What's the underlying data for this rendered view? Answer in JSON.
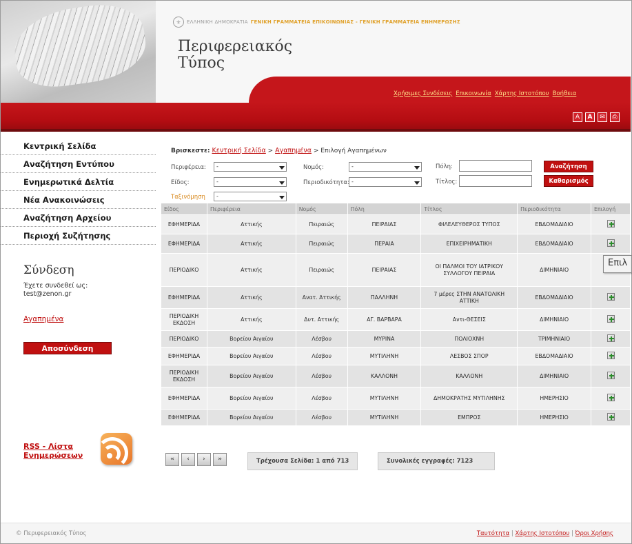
{
  "header": {
    "gov_hellenic": "ΕΛΛΗΝΙΚΗ ΔΗΜΟΚΡΑΤΙΑ",
    "gov_secretariat": "ΓΕΝΙΚΗ ΓΡΑΜΜΑΤΕΙΑ ΕΠΙΚΟΙΝΩΝΙΑΣ - ΓΕΝΙΚΗ ΓΡΑΜΜΑΤΕΙΑ ΕΝΗΜΕΡΩΣΗΣ",
    "site_title": "Περιφερειακός Τύπος",
    "top_links": [
      "Χρήσιμες Συνδέσεις",
      "Επικοινωνία",
      "Χάρτης Ιστοτόπου",
      "Βοήθεια"
    ],
    "tool_icons": [
      "font-small-icon",
      "font-large-icon",
      "email-icon",
      "print-icon"
    ]
  },
  "sidebar": {
    "nav": [
      "Κεντρική Σελίδα",
      "Αναζήτηση Εντύπου",
      "Ενημερωτικά Δελτία",
      "Νέα Ανακοινώσεις",
      "Αναζήτηση Αρχείου",
      "Περιοχή Συζήτησης"
    ],
    "login_title": "Σύνδεση",
    "login_sub": "Έχετε συνδεθεί ως:",
    "login_user": "test@zenon.gr",
    "favorites_link": "Αγαπημένα",
    "logout_button": "Αποσύνδεση",
    "rss_line1": "RSS - Λίστα",
    "rss_line2": "Ενημερώσεων"
  },
  "breadcrumb": {
    "label": "Βρισκεστε:",
    "home": "Κεντρική Σελίδα",
    "favorites": "Αγαπημένα",
    "current": "> Επιλογή Αγαπημένων"
  },
  "filters": {
    "region_label": "Περιφέρεια:",
    "region_value": "-",
    "prefecture_label": "Νομός:",
    "prefecture_value": "-",
    "city_label": "Πόλη:",
    "type_label": "Είδος:",
    "type_value": "-",
    "frequency_label": "Περιοδικότητα:",
    "frequency_value": "-",
    "title_label": "Τίτλος:",
    "sort_label": "Ταξινόμηση",
    "sort_value": "-",
    "search_button": "Αναζήτηση",
    "clear_button": "Καθαρισμός"
  },
  "table": {
    "headers": [
      "Είδος",
      "Περιφέρεια",
      "Νομός",
      "Πόλη",
      "Τίτλος",
      "Περιοδικότητα",
      "Επιλογή"
    ],
    "rows": [
      [
        "ΕΦΗΜΕΡΙΔΑ",
        "Αττικής",
        "Πειραιώς",
        "ΠΕΙΡΑΙΑΣ",
        "ΦΙΛΕΛΕΥΘΕΡΟΣ ΤΥΠΟΣ",
        "ΕΒΔΟΜΑΔΙΑΙΟ"
      ],
      [
        "ΕΦΗΜΕΡΙΔΑ",
        "Αττικής",
        "Πειραιώς",
        "ΠΕΡΑΙΑ",
        "ΕΠΙΧΕΙΡΗΜΑΤΙΚΗ",
        "ΕΒΔΟΜΑΔΙΑΙΟ"
      ],
      [
        "ΠΕΡΙΟΔΙΚΟ",
        "Αττικής",
        "Πειραιώς",
        "ΠΕΙΡΑΙΑΣ",
        "ΟΙ ΠΑΛΜΟΙ ΤΟΥ ΙΑΤΡΙΚΟΥ ΣΥΛΛΟΓΟΥ ΠΕΙΡΑΙΑ",
        "ΔΙΜΗΝΙΑΙΟ"
      ],
      [
        "ΕΦΗΜΕΡΙΔΑ",
        "Αττικής",
        "Ανατ. Αττικής",
        "ΠΑΛΛΗΝΗ",
        "7 μέρες ΣΤΗΝ ΑΝΑΤΟΛΙΚΗ ΑΤΤΙΚΗ",
        "ΕΒΔΟΜΑΔΙΑΙΟ"
      ],
      [
        "ΠΕΡΙΟΔΙΚΗ ΕΚΔΟΣΗ",
        "Αττικής",
        "Δυτ. Αττικής",
        "ΑΓ. ΒΑΡΒΑΡΑ",
        "Αντι-ΘΕΣΕΙΣ",
        "ΔΙΜΗΝΙΑΙΟ"
      ],
      [
        "ΠΕΡΙΟΔΙΚΟ",
        "Βορείου Αιγαίου",
        "Λέσβου",
        "ΜΥΡΙΝΑ",
        "ΠΟΛΙΟΧΝΗ",
        "ΤΡΙΜΗΝΙΑΙΟ"
      ],
      [
        "ΕΦΗΜΕΡΙΔΑ",
        "Βορείου Αιγαίου",
        "Λέσβου",
        "ΜΥΤΙΛΗΝΗ",
        "ΛΕΣΒΟΣ ΣΠΟΡ",
        "ΕΒΔΟΜΑΔΙΑΙΟ"
      ],
      [
        "ΠΕΡΙΟΔΙΚΗ ΕΚΔΟΣΗ",
        "Βορείου Αιγαίου",
        "Λέσβου",
        "ΚΑΛΛΟΝΗ",
        "ΚΑΛΛΟΝΗ",
        "ΔΙΜΗΝΙΑΙΟ"
      ],
      [
        "ΕΦΗΜΕΡΙΔΑ",
        "Βορείου Αιγαίου",
        "Λέσβου",
        "ΜΥΤΙΛΗΝΗ",
        "ΔΗΜΟΚΡΑΤΗΣ ΜΥΤΙΛΗΝΗΣ",
        "ΗΜΕΡΗΣΙΟ"
      ],
      [
        "ΕΦΗΜΕΡΙΔΑ",
        "Βορείου Αιγαίου",
        "Λέσβου",
        "ΜΥΤΙΛΗΝΗ",
        "ΕΜΠΡΟΣ",
        "ΗΜΕΡΗΣΙΟ"
      ]
    ],
    "tooltip": "Επιλ"
  },
  "pager": {
    "first": "«",
    "prev": "‹",
    "next": "›",
    "last": "»",
    "current_page": "Τρέχουσα Σελίδα: 1 από 713",
    "total_records": "Συνολικές εγγραφές: 7123"
  },
  "footer": {
    "copyright": "© Περιφερειακός Τύπος",
    "links": [
      "Ταυτότητα",
      "Χάρτης Ιστοτόπου",
      "Όροι Χρήσης"
    ]
  }
}
